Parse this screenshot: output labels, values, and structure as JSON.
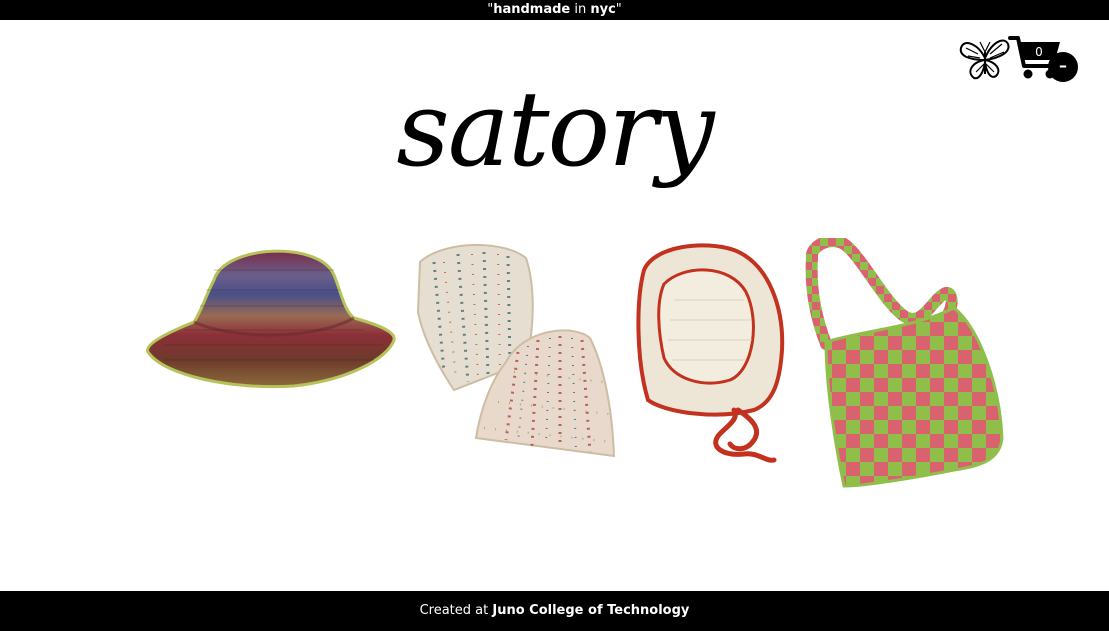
{
  "banner": {
    "quote_open": "\"",
    "word1": "handmade",
    "word2": " in ",
    "word3": "nyc",
    "quote_close": "\""
  },
  "nav": {
    "butterfly_icon": "butterfly-icon",
    "cart_icon": "cart-icon",
    "cart_count": "0",
    "cart_action": "–"
  },
  "brand": {
    "logo": "satory"
  },
  "products": [
    {
      "icon": "bucket-hat-image",
      "colors": [
        "#6b2b3a",
        "#5a4a78",
        "#8c3b2d",
        "#b6c25a"
      ]
    },
    {
      "icon": "beanies-image",
      "colors": [
        "#e8e2d5",
        "#3e6a6f",
        "#b24b4b",
        "#cdbda4"
      ]
    },
    {
      "icon": "bonnet-image",
      "colors": [
        "#efe9da",
        "#c2321f"
      ]
    },
    {
      "icon": "checkered-bag-image",
      "colors": [
        "#d9626f",
        "#8fbf4a"
      ]
    }
  ],
  "footer": {
    "prefix": "Created at ",
    "org": "Juno College of Technology"
  }
}
